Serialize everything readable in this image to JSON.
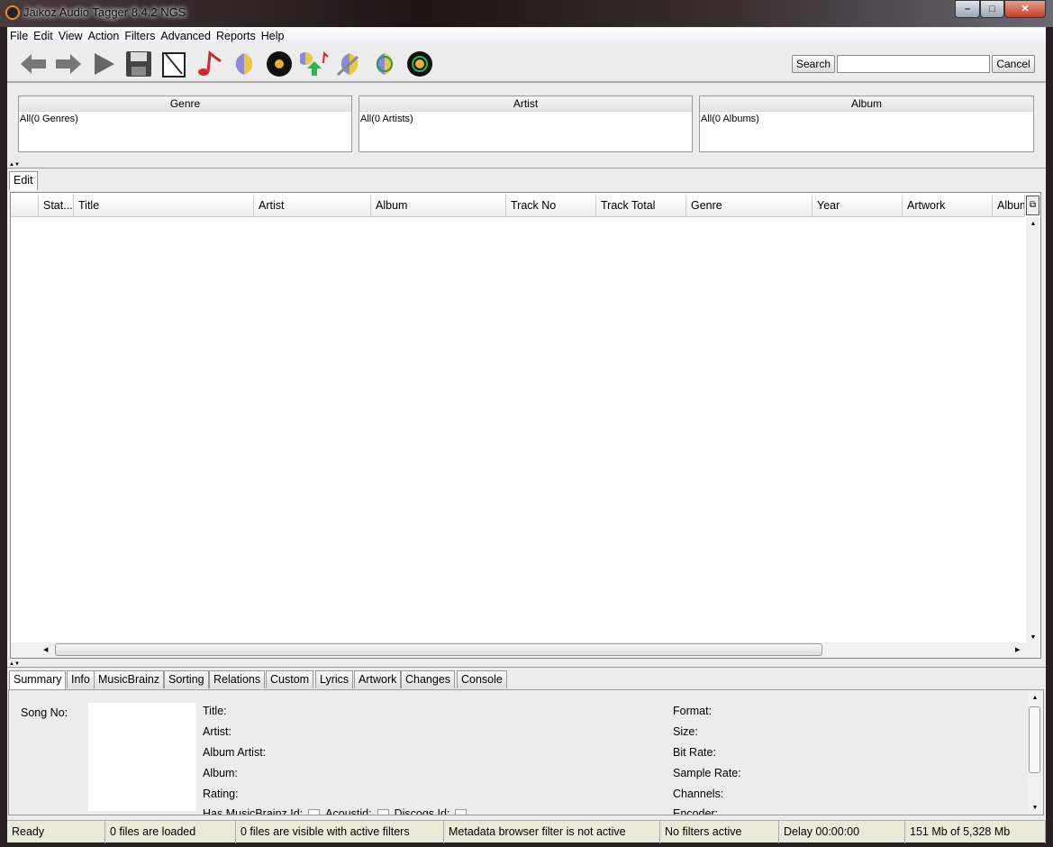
{
  "window": {
    "title": "Jaikoz Audio Tagger 8.4.2 NGS",
    "controls": [
      "minimize",
      "maximize",
      "close"
    ]
  },
  "menu": [
    "File",
    "Edit",
    "View",
    "Action",
    "Filters",
    "Advanced",
    "Reports",
    "Help"
  ],
  "toolbar": {
    "icons": [
      "back-arrow-icon",
      "forward-arrow-icon",
      "play-icon",
      "save-icon",
      "clipboard-icon",
      "music-note-icon",
      "brain-icon",
      "vinyl-record-icon",
      "upload-tags-icon",
      "brain-wrench-icon",
      "brain-cycle-icon",
      "vinyl-cycle-icon"
    ],
    "search_label": "Search",
    "search_value": "",
    "cancel_label": "Cancel"
  },
  "browser": [
    {
      "header": "Genre",
      "item": "All(0 Genres)"
    },
    {
      "header": "Artist",
      "item": "All(0 Artists)"
    },
    {
      "header": "Album",
      "item": "All(0 Albums)"
    }
  ],
  "edit_tab": "Edit",
  "table": {
    "columns": [
      "",
      "Stat...",
      "Title",
      "Artist",
      "Album",
      "Track No",
      "Track Total",
      "Genre",
      "Year",
      "Artwork",
      "Album"
    ],
    "rows": []
  },
  "bottom_tabs": [
    "Summary",
    "Info",
    "MusicBrainz",
    "Sorting",
    "Relations",
    "Custom",
    "Lyrics",
    "Artwork",
    "Changes",
    "Console"
  ],
  "summary": {
    "song_no": "Song No:",
    "left": [
      "Title:",
      "Artist:",
      "Album Artist:",
      "Album:",
      "Rating:"
    ],
    "checks": [
      "Has MusicBrainz Id:",
      "Acoustid:",
      "Discogs Id:"
    ],
    "right": [
      "Format:",
      "Size:",
      "Bit Rate:",
      "Sample Rate:",
      "Channels:",
      "Encoder:"
    ]
  },
  "status": [
    "Ready",
    "0 files are loaded",
    "0 files are visible with active filters",
    "Metadata browser filter is not active",
    "No filters active",
    "Delay 00:00:00",
    "151 Mb of 5,328 Mb"
  ]
}
